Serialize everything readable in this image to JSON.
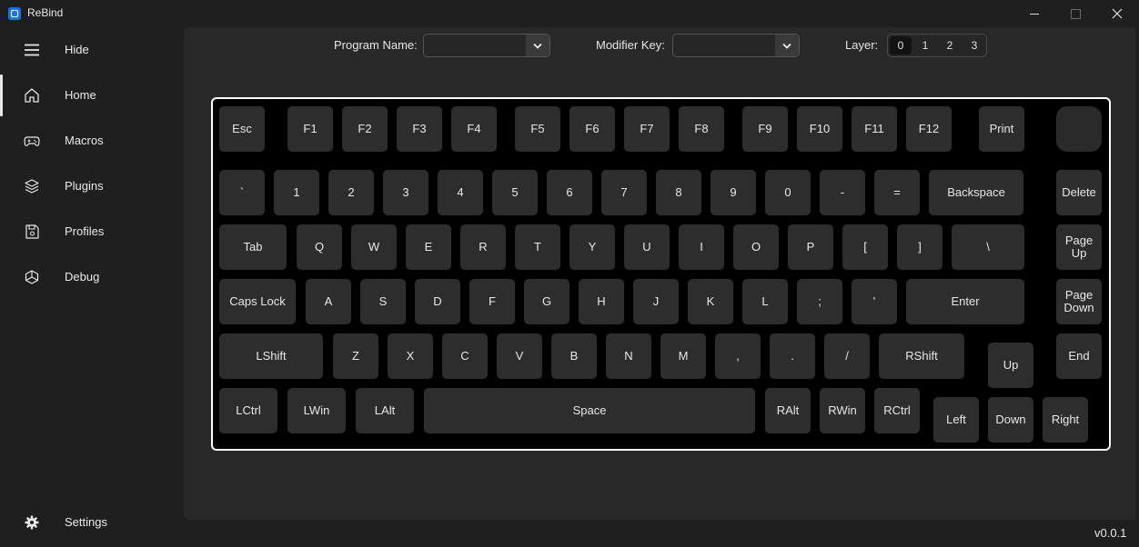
{
  "window": {
    "title": "ReBind",
    "controls": [
      "minimize",
      "maximize",
      "close"
    ]
  },
  "sidebar": {
    "items": [
      {
        "label": "Hide",
        "icon": "hamburger-icon"
      },
      {
        "label": "Home",
        "icon": "home-icon",
        "active": true
      },
      {
        "label": "Macros",
        "icon": "gamepad-icon"
      },
      {
        "label": "Plugins",
        "icon": "layers-icon"
      },
      {
        "label": "Profiles",
        "icon": "save-icon"
      },
      {
        "label": "Debug",
        "icon": "debug-icon"
      }
    ],
    "settings": {
      "label": "Settings",
      "icon": "gear-icon"
    }
  },
  "top_bar": {
    "program_name": {
      "label": "Program Name:",
      "value": ""
    },
    "modifier_key": {
      "label": "Modifier Key:",
      "value": ""
    },
    "layer": {
      "label": "Layer:",
      "options": [
        "0",
        "1",
        "2",
        "3"
      ],
      "selected": "0"
    }
  },
  "keyboard": {
    "row0": [
      "Esc",
      "F1",
      "F2",
      "F3",
      "F4",
      "F5",
      "F6",
      "F7",
      "F8",
      "F9",
      "F10",
      "F11",
      "F12",
      "Print",
      ""
    ],
    "row1": [
      "`",
      "1",
      "2",
      "3",
      "4",
      "5",
      "6",
      "7",
      "8",
      "9",
      "0",
      "-",
      "=",
      "Backspace",
      "Delete"
    ],
    "row2": [
      "Tab",
      "Q",
      "W",
      "E",
      "R",
      "T",
      "Y",
      "U",
      "I",
      "O",
      "P",
      "[",
      "]",
      "\\",
      "Page Up"
    ],
    "row3": [
      "Caps Lock",
      "A",
      "S",
      "D",
      "F",
      "G",
      "H",
      "J",
      "K",
      "L",
      ";",
      "'",
      "Enter",
      "Page Down"
    ],
    "row4": [
      "LShift",
      "Z",
      "X",
      "C",
      "V",
      "B",
      "N",
      "M",
      ",",
      ".",
      "/",
      "RShift",
      "Up",
      "End"
    ],
    "row5": [
      "LCtrl",
      "LWin",
      "LAlt",
      "Space",
      "RAlt",
      "RWin",
      "RCtrl",
      "Left",
      "Down",
      "Right"
    ]
  },
  "footer": {
    "version": "v0.0.1"
  },
  "colors": {
    "accent": "#1a73e8",
    "keyboard_border": "#ffffff",
    "key_bg": "#2d2d2d"
  }
}
